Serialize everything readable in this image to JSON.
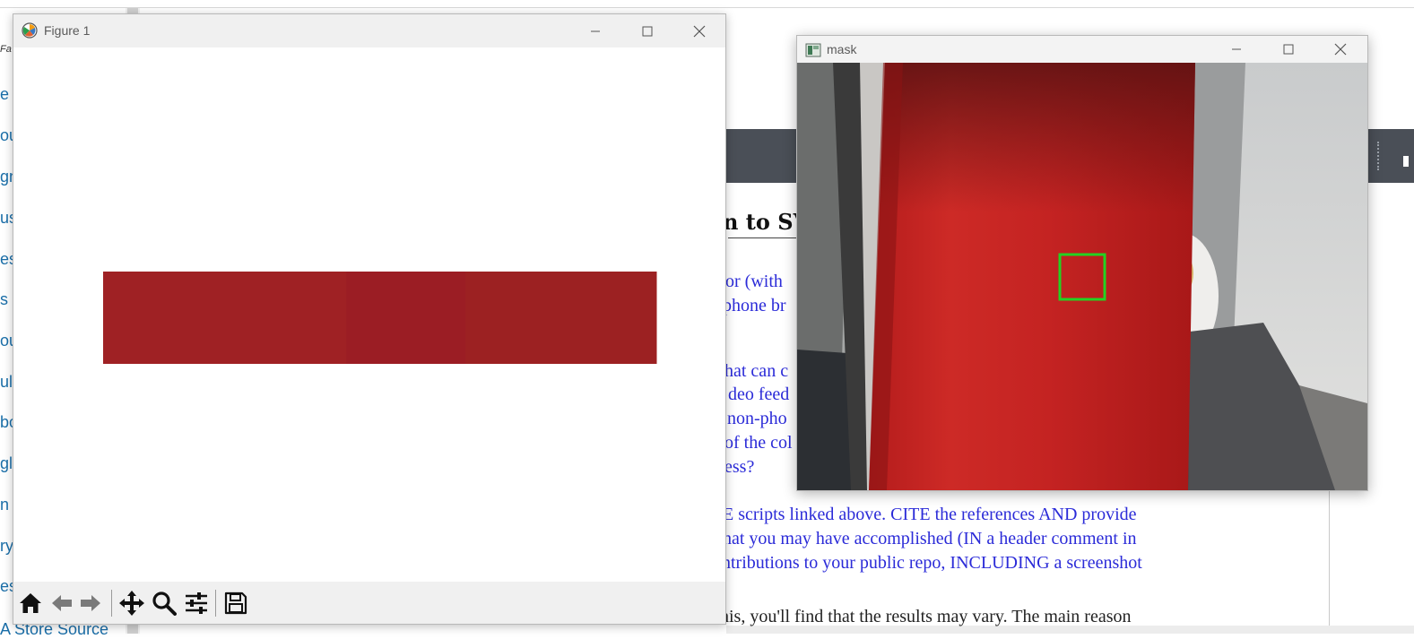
{
  "background": {
    "sidebar_fav": "Fa",
    "sidebar_items": [
      "e",
      "ou",
      "gn",
      "us",
      "es",
      "s",
      "ou",
      "ul",
      "bo",
      "gle",
      "n",
      "ry",
      "es"
    ],
    "sidebar_bottom": "A Store Source",
    "pdf_heading": "n to SV",
    "pdf_lines": [
      "or (with",
      "phone br",
      "hat can c",
      "deo feed",
      "non-pho",
      "of the col",
      "ess?",
      "E scripts linked above.  CITE the references AND provide",
      "hat you may have accomplished (IN a header comment in",
      "ntributions to your public repo, INCLUDING a screenshot",
      "his, you'll find that the results may vary.  The main reason"
    ]
  },
  "figure_window": {
    "title": "Figure 1",
    "controls": [
      "minimize",
      "maximize",
      "close"
    ],
    "toolbar": [
      {
        "name": "home-icon",
        "label": "Home"
      },
      {
        "name": "back-arrow-icon",
        "label": "Back"
      },
      {
        "name": "forward-arrow-icon",
        "label": "Forward"
      },
      {
        "name": "pan-move-icon",
        "label": "Pan"
      },
      {
        "name": "zoom-magnifier-icon",
        "label": "Zoom"
      },
      {
        "name": "configure-subplots-icon",
        "label": "Configure subplots"
      },
      {
        "name": "save-disk-icon",
        "label": "Save"
      }
    ],
    "color_bar": {
      "segments": [
        {
          "color": "#9f2124",
          "fraction": 0.44
        },
        {
          "color": "#9b1d24",
          "fraction": 0.215
        },
        {
          "color": "#9c2122",
          "fraction": 0.345
        }
      ]
    }
  },
  "mask_window": {
    "title": "mask",
    "controls": [
      "minimize",
      "maximize",
      "close"
    ],
    "selection_box_color": "#22d322"
  }
}
